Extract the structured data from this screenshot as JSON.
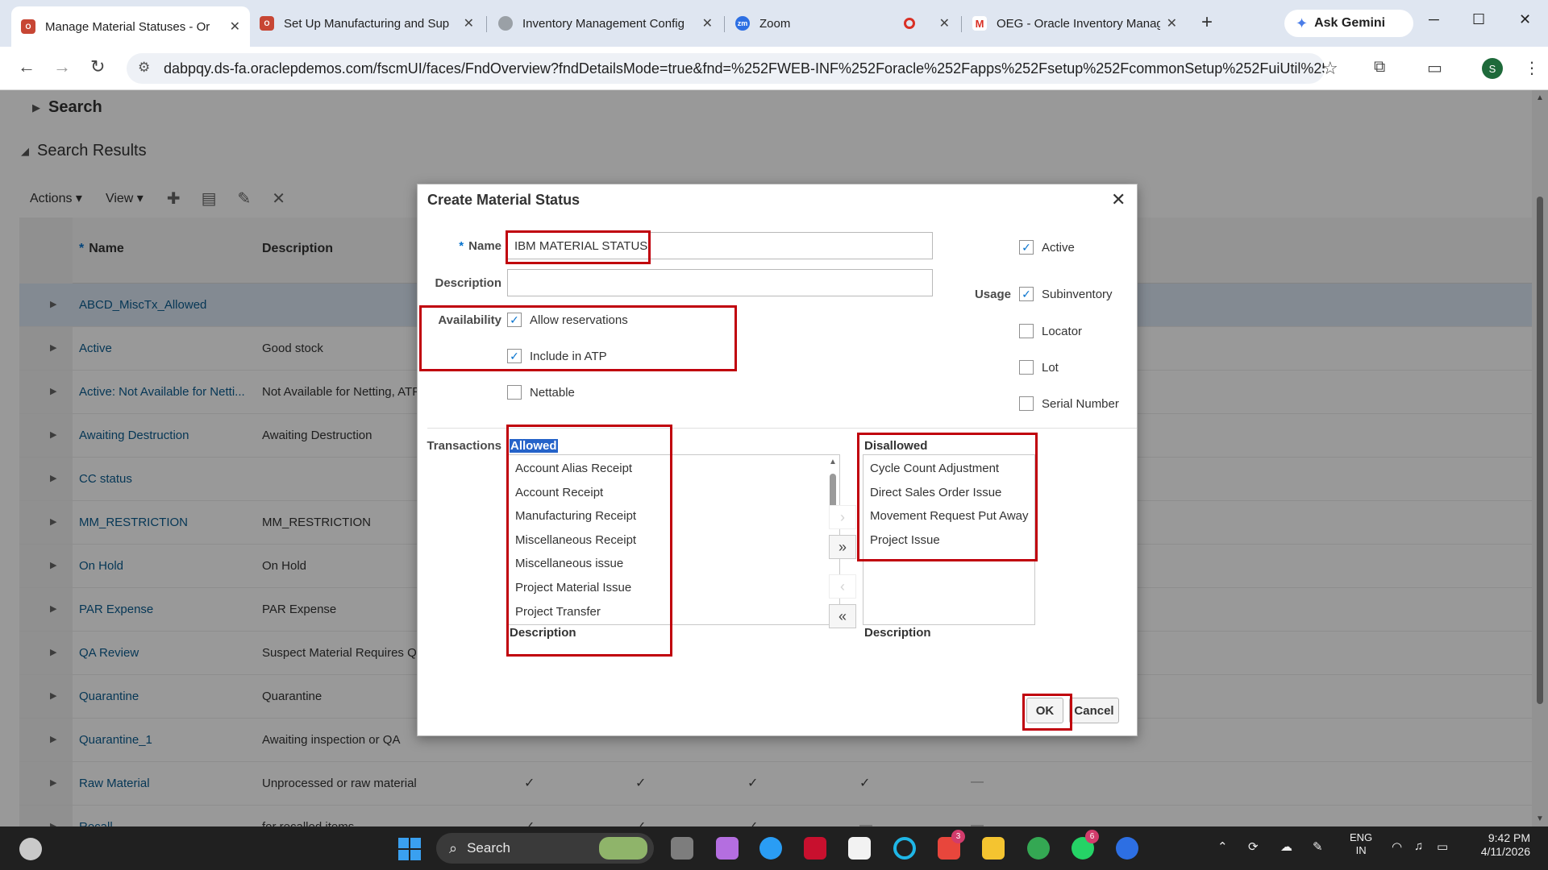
{
  "browser": {
    "tabs": [
      {
        "title": "Manage Material Statuses - Or",
        "favicon": "oracle-icon"
      },
      {
        "title": "Set Up Manufacturing and Sup",
        "favicon": "oracle-icon"
      },
      {
        "title": "Inventory Management Config",
        "favicon": "globe-icon"
      },
      {
        "title": "Zoom",
        "favicon": "zoom-icon"
      },
      {
        "title": "OEG - Oracle Inventory Manag",
        "favicon": "gmail-icon"
      }
    ],
    "new_tab": "+",
    "gemini_label": "Ask Gemini",
    "url": "dabpqy.ds-fa.oraclepdemos.com/fscmUI/faces/FndOverview?fndDetailsMode=true&fnd=%252FWEB-INF%252Foracle%252Fapps%252Fsetup%252FcommonSetup%252FuiUtil%252F...",
    "profile_initial": "S"
  },
  "page": {
    "search_label": "Search",
    "results_label": "Search Results",
    "actions_menu": "Actions",
    "view_menu": "View",
    "columns": {
      "name": "Name",
      "description": "Description"
    },
    "rows": [
      {
        "name": "ABCD_MiscTx_Allowed",
        "description": ""
      },
      {
        "name": "Active",
        "description": "Good stock"
      },
      {
        "name": "Active: Not Available for Netti...",
        "description": "Not Available for Netting, ATP"
      },
      {
        "name": "Awaiting Destruction",
        "description": "Awaiting Destruction"
      },
      {
        "name": "CC status",
        "description": ""
      },
      {
        "name": "MM_RESTRICTION",
        "description": "MM_RESTRICTION"
      },
      {
        "name": "On Hold",
        "description": "On Hold"
      },
      {
        "name": "PAR Expense",
        "description": "PAR Expense"
      },
      {
        "name": "QA Review",
        "description": "Suspect Material Requires QA"
      },
      {
        "name": "Quarantine",
        "description": "Quarantine"
      },
      {
        "name": "Quarantine_1",
        "description": "Awaiting inspection or QA"
      },
      {
        "name": "Raw Material",
        "description": "Unprocessed or raw material"
      },
      {
        "name": "Recall",
        "description": "for recalled items"
      }
    ],
    "check_mark": "✓",
    "dash": "—"
  },
  "dialog": {
    "title": "Create Material Status",
    "name_label": "Name",
    "name_value": "IBM MATERIAL STATUS",
    "description_label": "Description",
    "description_value": "",
    "availability_label": "Availability",
    "availability": [
      {
        "label": "Allow reservations",
        "checked": true
      },
      {
        "label": "Include in ATP",
        "checked": true
      },
      {
        "label": "Nettable",
        "checked": false
      }
    ],
    "active_label": "Active",
    "active_checked": true,
    "usage_label": "Usage",
    "usage": [
      {
        "label": "Subinventory",
        "checked": true
      },
      {
        "label": "Locator",
        "checked": false
      },
      {
        "label": "Lot",
        "checked": false
      },
      {
        "label": "Serial Number",
        "checked": false
      }
    ],
    "transactions_label": "Transactions",
    "allowed_label": "Allowed",
    "allowed": [
      "Account Alias Receipt",
      "Account Receipt",
      "Manufacturing Receipt",
      "Miscellaneous Receipt",
      "Miscellaneous issue",
      "Project Material Issue",
      "Project Transfer"
    ],
    "disallowed_label": "Disallowed",
    "disallowed": [
      "Cycle Count Adjustment",
      "Direct Sales Order Issue",
      "Movement Request Put Away",
      "Project Issue"
    ],
    "list_description_label": "Description",
    "ok_label": "OK",
    "cancel_label": "Cancel"
  },
  "taskbar": {
    "search_label": "Search",
    "badges": [
      "3",
      "6"
    ],
    "lang_top": "ENG",
    "lang_bottom": "IN",
    "time": "9:42 PM",
    "date": "4/11/2026"
  },
  "colors": {
    "oracle_red": "#c74634",
    "link_blue": "#0b5c8f",
    "highlight_red": "#c0000c",
    "allowed_highlight": "#2563c9"
  }
}
